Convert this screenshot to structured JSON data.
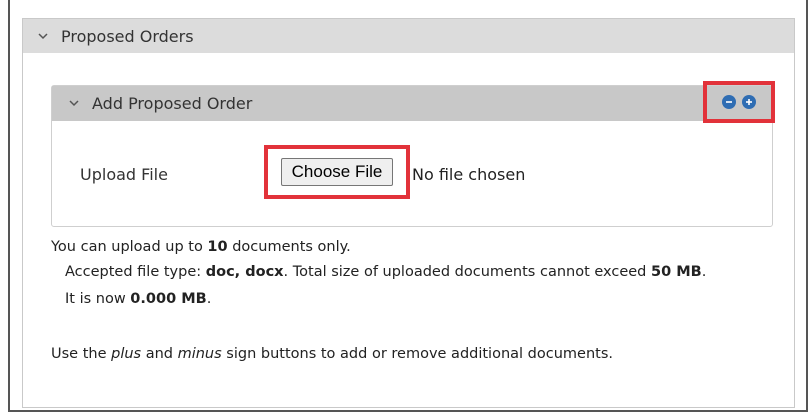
{
  "section": {
    "title": "Proposed Orders"
  },
  "subsection": {
    "title": "Add Proposed Order",
    "minus_icon": "minus-circle-icon",
    "plus_icon": "plus-circle-icon"
  },
  "upload": {
    "label": "Upload File",
    "button_label": "Choose File",
    "status": "No file chosen"
  },
  "info": {
    "limit_prefix": "You can upload up to",
    "limit_count": "10",
    "limit_suffix": "documents only.",
    "types_prefix": "Accepted file type:",
    "types_value": "doc, docx",
    "size_text": ". Total size of uploaded documents cannot exceed",
    "size_value": "50 MB",
    "size_end": ".",
    "now_prefix": "It is now",
    "now_value": "0.000 MB",
    "now_end": ".",
    "help_1": "Use the",
    "help_plus": "plus",
    "help_2": "and",
    "help_minus": "minus",
    "help_3": "sign buttons to add or remove additional documents."
  },
  "colors": {
    "accent_blue": "#2f6db3",
    "highlight_red": "#e2323a"
  }
}
